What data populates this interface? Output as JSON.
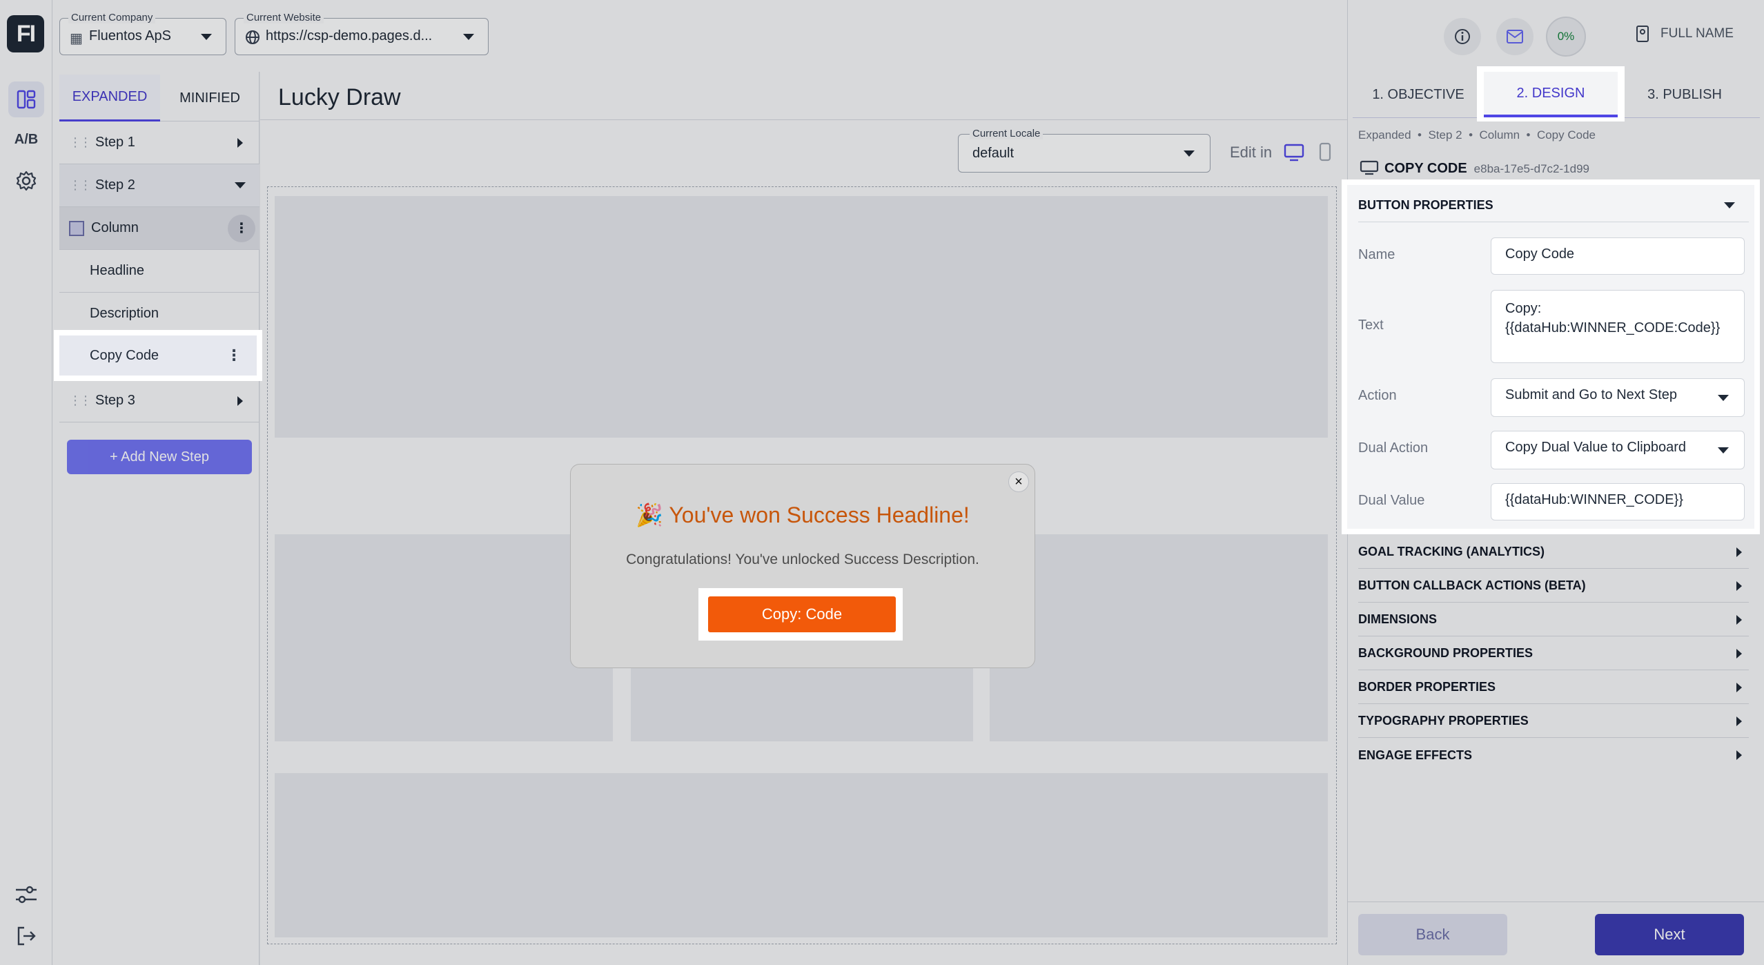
{
  "app": {
    "logo_text": "FI",
    "ab_label": "A/B"
  },
  "topbar": {
    "company_label": "Current Company",
    "company_value": "Fluentos ApS",
    "website_label": "Current Website",
    "website_value": "https://csp-demo.pages.d..."
  },
  "steps_panel": {
    "tabs": [
      "EXPANDED",
      "MINIFIED"
    ],
    "step1": "Step 1",
    "step2": "Step 2",
    "column": "Column",
    "headline": "Headline",
    "description": "Description",
    "copy_code": "Copy Code",
    "step3": "Step 3",
    "add_step": "+ Add New Step"
  },
  "canvas": {
    "title": "Lucky Draw",
    "locale_label": "Current Locale",
    "locale_value": "default",
    "edit_in": "Edit in"
  },
  "modal": {
    "headline_emoji": "🎉",
    "headline": "You've won Success Headline!",
    "description": "Congratulations! You've unlocked Success Description.",
    "button": "Copy: Code",
    "close": "×"
  },
  "right": {
    "progress": "0%",
    "full_name": "FULL NAME",
    "tabs": [
      "1. OBJECTIVE",
      "2. DESIGN",
      "3. PUBLISH"
    ],
    "breadcrumbs": [
      "Expanded",
      "Step 2",
      "Column",
      "Copy Code"
    ],
    "component_title": "COPY CODE",
    "component_id": "e8ba-17e5-d7c2-1d99",
    "button_properties": "BUTTON PROPERTIES",
    "name_label": "Name",
    "name_value": "Copy Code",
    "text_label": "Text",
    "text_value_1": "Copy:",
    "text_value_2": "{{dataHub:WINNER_CODE:Code}}",
    "action_label": "Action",
    "action_value": "Submit and Go to Next Step",
    "dual_action_label": "Dual Action",
    "dual_action_value": "Copy Dual Value to Clipboard",
    "dual_value_label": "Dual Value",
    "dual_value_value": "{{dataHub:WINNER_CODE}}",
    "sections": [
      "GOAL TRACKING (ANALYTICS)",
      "BUTTON CALLBACK ACTIONS (BETA)",
      "DIMENSIONS",
      "BACKGROUND PROPERTIES",
      "BORDER PROPERTIES",
      "TYPOGRAPHY PROPERTIES",
      "ENGAGE EFFECTS"
    ],
    "back": "Back",
    "next": "Next"
  },
  "colors": {
    "accent": "#4f46e5",
    "cta": "#f25a0a",
    "next_button": "#3b3bb0"
  }
}
